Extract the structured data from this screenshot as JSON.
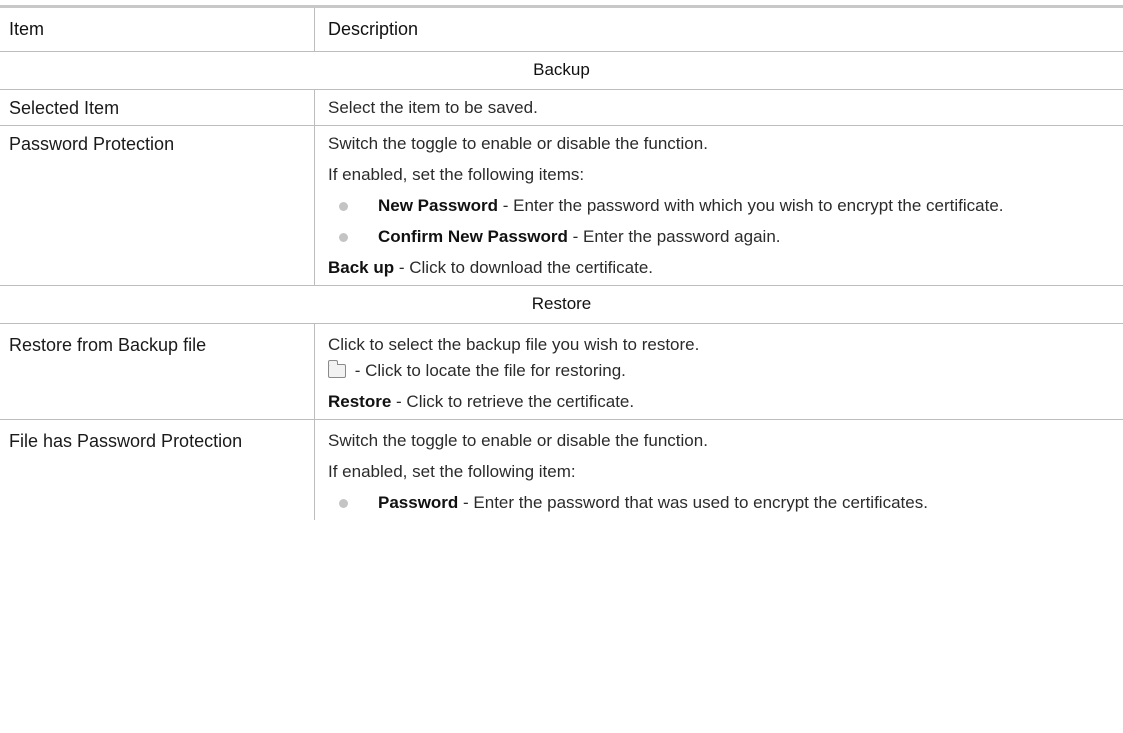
{
  "header": {
    "item": "Item",
    "description": "Description"
  },
  "sections": {
    "backup": {
      "title": "Backup",
      "selected_item": {
        "label": "Selected Item",
        "desc": "Select the item to be saved."
      },
      "password_protection": {
        "label": "Password Protection",
        "line1": "Switch the toggle to enable or disable the function.",
        "line2": "If enabled, set the following items:",
        "bullet1_bold": "New Password",
        "bullet1_text": " - Enter the password with which you wish to encrypt the certificate.",
        "bullet2_bold": "Confirm New Password",
        "bullet2_text": " - Enter the password again.",
        "action_bold": "Back up",
        "action_text": " - Click to download the certificate."
      }
    },
    "restore": {
      "title": "Restore",
      "restore_from_file": {
        "label": "Restore from Backup file",
        "line1": "Click to select the backup file you wish to restore.",
        "icon": "folder-icon",
        "icon_text": " - Click to locate the file for restoring.",
        "action_bold": "Restore",
        "action_text": " - Click to retrieve the certificate."
      },
      "file_password": {
        "label": "File has Password Protection",
        "line1": "Switch the toggle to enable or disable the function.",
        "line2": "If enabled, set the following item:",
        "bullet1_bold": "Password",
        "bullet1_text": " - Enter the password that was used to encrypt the certificates."
      }
    }
  }
}
